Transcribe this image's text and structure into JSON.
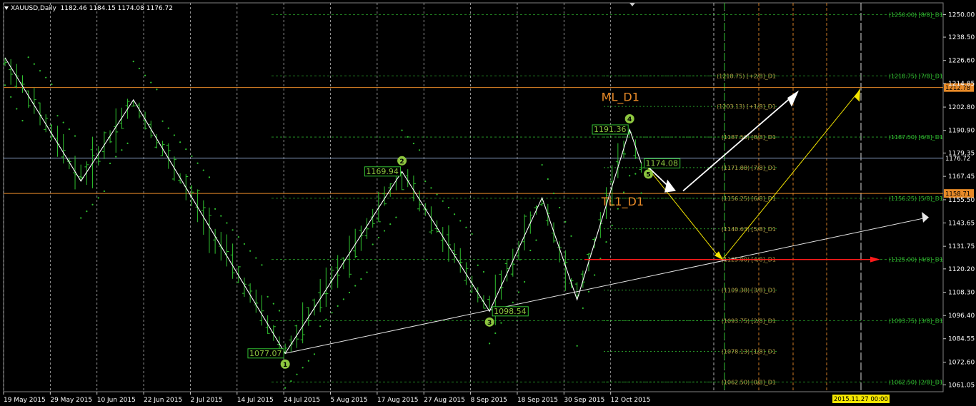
{
  "header": {
    "symbol": "XAUUSD,Daily",
    "ohlc": "1182.46 1184.15 1174.08 1176.72"
  },
  "colors": {
    "background": "#000000",
    "grid": "#c8c8c8",
    "bars": "#2fc12f",
    "sar": "#2fc12f",
    "zigzag": "#ffffff",
    "orange_line": "#e88a28",
    "blue_line": "#8aa0c8",
    "fib_lines": "#32c232",
    "murrey_labels": "#b7a246",
    "red_arrow": "#ff1a1a",
    "yellow_arrow": "#f5e600",
    "white_arrow": "#ffffff",
    "text_orange": "#e88a28",
    "marker_fill": "#8dc63f"
  },
  "chart_data": {
    "type": "bar",
    "title": "XAUUSD,Daily",
    "ylim": [
      1057.5,
      1256
    ],
    "y_ticks": [
      "1250.00",
      "1238.50",
      "1226.60",
      "1214.85",
      "1202.80",
      "1190.90",
      "1179.35",
      "1167.45",
      "1155.50",
      "1143.65",
      "1131.75",
      "1120.20",
      "1108.30",
      "1096.40",
      "1084.55",
      "1072.60",
      "1061.05"
    ],
    "y_tick_values": [
      1250.0,
      1238.5,
      1226.6,
      1214.85,
      1202.8,
      1190.9,
      1179.35,
      1167.45,
      1155.5,
      1143.65,
      1131.75,
      1120.2,
      1108.3,
      1096.4,
      1084.55,
      1072.6,
      1061.05
    ],
    "x_labels": [
      "19 May 2015",
      "29 May 2015",
      "10 Jun 2015",
      "22 Jun 2015",
      "2 Jul 2015",
      "14 Jul 2015",
      "24 Jul 2015",
      "5 Aug 2015",
      "17 Aug 2015",
      "27 Aug 2015",
      "8 Sep 2015",
      "18 Sep 2015",
      "30 Sep 2015",
      "12 Oct 2015"
    ],
    "x_label_bars": [
      0,
      8,
      16,
      24,
      32,
      40,
      48,
      56,
      64,
      72,
      80,
      88,
      96,
      104
    ],
    "time_marker": "2015.11.27 00:00",
    "grid": true,
    "horizontal_lines": [
      {
        "value": 1212.78,
        "label": "1212.78",
        "kind": "orange"
      },
      {
        "value": 1176.72,
        "label": "1176.72",
        "kind": "blue"
      },
      {
        "value": 1158.71,
        "label": "1158.71",
        "kind": "orange"
      }
    ],
    "murrey_left": [
      {
        "value": 1218.75,
        "label": "(1218.75) [+2/8]_D1"
      },
      {
        "value": 1203.13,
        "label": "(1203.13) [+1/8]_D1"
      },
      {
        "value": 1187.5,
        "label": "(1187.50) [8/8]_D1"
      },
      {
        "value": 1171.88,
        "label": "(1171.88) [7/8]_D1"
      },
      {
        "value": 1156.25,
        "label": "(1156.25) [6/8]_D1"
      },
      {
        "value": 1140.63,
        "label": "(1140.63) [5/8]_D1"
      },
      {
        "value": 1125.0,
        "label": "(1125.00) [4/8]_D1"
      },
      {
        "value": 1109.38,
        "label": "(1109.38) [3/8]_D1"
      },
      {
        "value": 1093.75,
        "label": "(1093.75) [2/8]_D1"
      },
      {
        "value": 1078.13,
        "label": "(1078.13) [1/8]_D1"
      },
      {
        "value": 1062.5,
        "label": "(1062.50) [0/8]_D1"
      }
    ],
    "murrey_right": [
      {
        "value": 1250.0,
        "label": "(1250.00) [8/8]_D1"
      },
      {
        "value": 1218.75,
        "label": "(1218.75) [7/8]_D1"
      },
      {
        "value": 1187.5,
        "label": "(1187.50) [6/8]_D1"
      },
      {
        "value": 1156.25,
        "label": "(1156.25) [5/8]_D1"
      },
      {
        "value": 1125.0,
        "label": "(1125.00) [4/8]_D1"
      },
      {
        "value": 1093.75,
        "label": "(1093.75) [3/8]_D1"
      },
      {
        "value": 1062.5,
        "label": "(1062.50) [2/8]_D1"
      }
    ],
    "zigzag": [
      {
        "bar": 0,
        "value": 1228.0
      },
      {
        "bar": 13,
        "value": 1165.0
      },
      {
        "bar": 22,
        "value": 1206.5
      },
      {
        "bar": 48,
        "value": 1077.07
      },
      {
        "bar": 68,
        "value": 1169.94
      },
      {
        "bar": 83,
        "value": 1098.54
      },
      {
        "bar": 92,
        "value": 1156.5
      },
      {
        "bar": 98,
        "value": 1104.5
      },
      {
        "bar": 107,
        "value": 1191.36
      },
      {
        "bar": 109,
        "value": 1174.08
      }
    ],
    "price_labels": [
      {
        "text": "1077.07",
        "bar": 48,
        "value": 1077.07,
        "side": "left"
      },
      {
        "text": "1169.94",
        "bar": 68,
        "value": 1169.94,
        "side": "left"
      },
      {
        "text": "1098.54",
        "bar": 83,
        "value": 1098.54,
        "side": "right"
      },
      {
        "text": "1191.36",
        "bar": 107,
        "value": 1191.36,
        "side": "left"
      },
      {
        "text": "1174.08",
        "bar": 109,
        "value": 1174.08,
        "side": "right"
      }
    ],
    "wave_markers": [
      {
        "label": "1",
        "bar": 48,
        "value": 1077.07,
        "pos": "below"
      },
      {
        "label": "2",
        "bar": 68,
        "value": 1169.94,
        "pos": "above"
      },
      {
        "label": "3",
        "bar": 83,
        "value": 1098.54,
        "pos": "below"
      },
      {
        "label": "4",
        "bar": 107,
        "value": 1191.36,
        "pos": "above"
      },
      {
        "label": "5",
        "bar": 109,
        "value": 1174.08,
        "pos": "belowleft"
      }
    ],
    "annotations": [
      {
        "text": "ML_D1",
        "bar": 104,
        "value": 1206.0
      },
      {
        "text": "TL1_D1",
        "bar": 104,
        "value": 1152.5
      }
    ]
  }
}
